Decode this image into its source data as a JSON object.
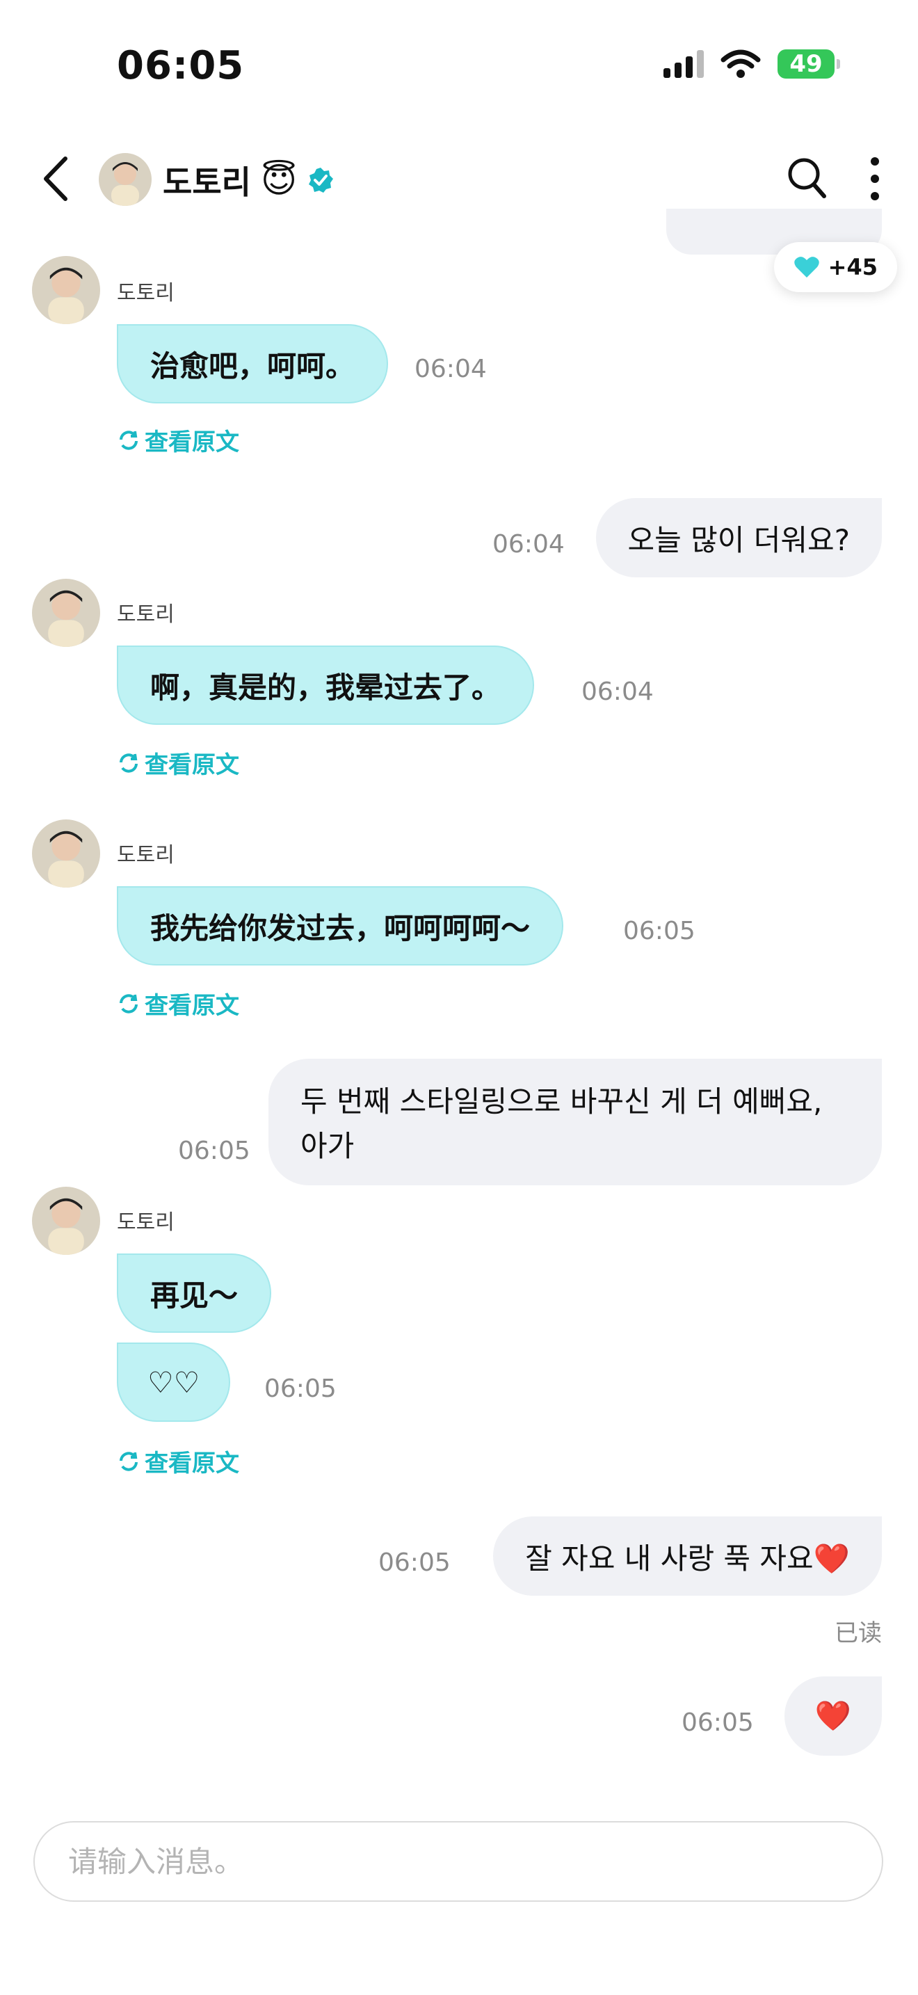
{
  "status_bar": {
    "time": "06:05",
    "battery": "49"
  },
  "header": {
    "contact_name": "도토리",
    "contact_emoji": "😇",
    "likes": "+45"
  },
  "messages": [
    {
      "sender": "도토리",
      "text": "治愈吧，呵呵。",
      "time": "06:04",
      "translate": "查看原文"
    },
    {
      "text": "오늘 많이 더워요?",
      "time": "06:04"
    },
    {
      "sender": "도토리",
      "text": "啊，真是的，我晕过去了。",
      "time": "06:04",
      "translate": "查看原文"
    },
    {
      "sender": "도토리",
      "text": "我先给你发过去，呵呵呵呵～",
      "time": "06:05",
      "translate": "查看原文"
    },
    {
      "line1": "두 번째 스타일링으로 바꾸신 게 더 예뻐요,",
      "line2": "아가",
      "time": "06:05"
    },
    {
      "sender": "도토리",
      "text": "再见～",
      "text2": "♡♡",
      "time": "06:05",
      "translate": "查看原文"
    },
    {
      "text": "잘 자요 내 사랑 푹 자요❤️",
      "time": "06:05"
    },
    {
      "text": "❤️",
      "time": "06:05",
      "read": "已读"
    }
  ],
  "input": {
    "placeholder": "请输入消息。"
  },
  "colors": {
    "accent": "#1ab8c4",
    "incoming_bubble": "#bff2f4",
    "outgoing_bubble": "#f0f1f5"
  }
}
